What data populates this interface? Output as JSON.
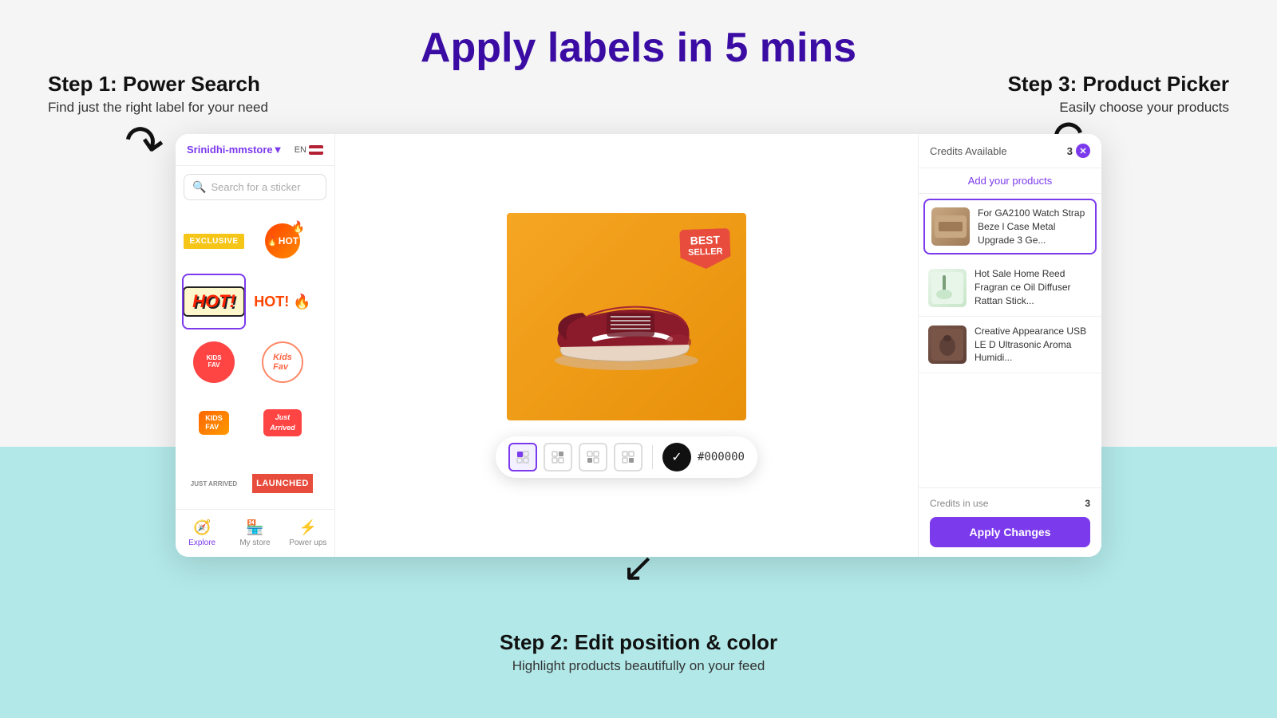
{
  "page": {
    "title": "Apply labels in 5 mins",
    "background_top_color": "#f5f5f5",
    "background_bottom_color": "#b2e8e8"
  },
  "step1": {
    "title": "Step 1: Power Search",
    "subtitle": "Find just the right label for your need"
  },
  "step2": {
    "title": "Step 2: Edit position & color",
    "subtitle": "Highlight products beautifully on your feed"
  },
  "step3": {
    "title": "Step 3: Product Picker",
    "subtitle": "Easily choose your products"
  },
  "sidebar": {
    "store_name": "Srinidhi-mmstore",
    "store_arrow": "▼",
    "lang": "EN",
    "search_placeholder": "Search for a sticker",
    "stickers": [
      {
        "id": "exclusive",
        "label": "EXCLUSIVE",
        "type": "exclusive"
      },
      {
        "id": "hot-fire",
        "label": "🔥HOT",
        "type": "hot-fire"
      },
      {
        "id": "hot-comic",
        "label": "HOT!",
        "type": "hot-comic"
      },
      {
        "id": "hot-text",
        "label": "HOT!",
        "type": "hot-text"
      },
      {
        "id": "kids-fav-circle",
        "label": "KIDS FAV",
        "type": "kids-fav-circle"
      },
      {
        "id": "kids-fav-script",
        "label": "Kids Fav",
        "type": "kids-fav-script"
      },
      {
        "id": "kids-fav-badge",
        "label": "KIDS FAV",
        "type": "kids-fav-badge"
      },
      {
        "id": "just-arrived",
        "label": "Just Arrived",
        "type": "just-arrived"
      },
      {
        "id": "launched",
        "label": "LAUNCHED",
        "type": "launched"
      }
    ],
    "nav_items": [
      {
        "id": "explore",
        "icon": "🧭",
        "label": "Explore",
        "active": true
      },
      {
        "id": "my-store",
        "icon": "🏪",
        "label": "My store",
        "active": false
      },
      {
        "id": "power-ups",
        "icon": "⚡",
        "label": "Power ups",
        "active": false
      }
    ]
  },
  "canvas": {
    "badge_text_line1": "BEST",
    "badge_text_line2": "SELLER"
  },
  "toolbar": {
    "color_hex": "#000000",
    "position_options": [
      "top-left",
      "top-right",
      "bottom-left",
      "bottom-right"
    ]
  },
  "right_panel": {
    "credits_label": "Credits Available",
    "credits_count": "3",
    "add_products_label": "Add your products",
    "products": [
      {
        "id": 1,
        "name": "For GA2100 Watch Strap Beze l Case Metal Upgrade 3 Ge...",
        "thumb_type": "1",
        "active": true
      },
      {
        "id": 2,
        "name": "Hot Sale Home Reed Fragran ce Oil Diffuser Rattan Stick...",
        "thumb_type": "2",
        "active": false
      },
      {
        "id": 3,
        "name": "Creative Appearance USB LE D Ultrasonic Aroma Humidi...",
        "thumb_type": "3",
        "active": false
      }
    ],
    "credits_in_use_label": "Credits in use",
    "credits_in_use_value": "3",
    "apply_button_label": "Apply Changes"
  }
}
